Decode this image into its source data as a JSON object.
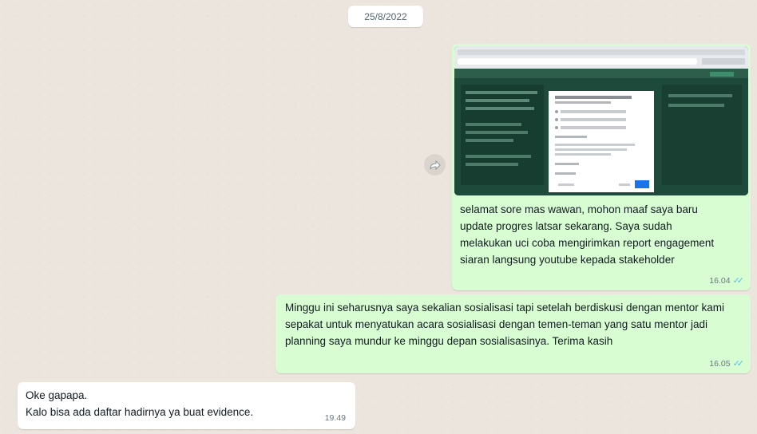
{
  "chat": {
    "date": "25/8/2022"
  },
  "messages": [
    {
      "id": "msg1",
      "direction": "outgoing",
      "has_image": true,
      "text": "selamat sore mas wawan, mohon maaf saya baru update progres latsar sekarang. Saya sudah melakukan uci coba mengirimkan report engagement siaran langsung youtube kepada stakeholder",
      "time": "16.04"
    },
    {
      "id": "msg2",
      "direction": "outgoing",
      "has_image": false,
      "text": "Minggu ini seharusnya saya sekalian sosialisasi tapi setelah berdiskusi dengan mentor kami sepakat untuk menyatukan acara sosialisasi dengan temen-teman yang satu mentor jadi planning saya mundur ke minggu depan sosialisasinya. Terima kasih",
      "time": "16.05"
    },
    {
      "id": "msg3",
      "direction": "incoming",
      "has_image": false,
      "text_lines": [
        "Oke gapapa.",
        "Kalo bisa ada daftar hadirnya ya buat evidence."
      ],
      "time": "19.49"
    }
  ],
  "icons": {
    "forward": "forward-icon",
    "read_receipt": "double-check-icon"
  },
  "colors": {
    "outgoing_bubble": "#d9fdd3",
    "incoming_bubble": "#ffffff",
    "read_tick": "#53bdeb",
    "background": "#ece5dd"
  }
}
